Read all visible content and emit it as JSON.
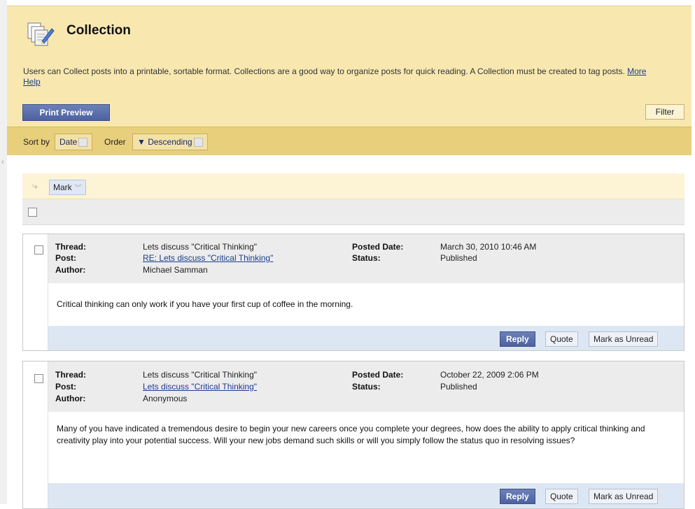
{
  "header": {
    "title": "Collection",
    "description": "Users can Collect posts into a printable, sortable format. Collections are a good way to organize posts for quick reading. A Collection must be created to tag posts.",
    "help_link": "More Help",
    "print_preview_label": "Print Preview",
    "filter_label": "Filter"
  },
  "sortbar": {
    "sort_by_label": "Sort by",
    "sort_value": "Date",
    "order_label": "Order",
    "order_value": "▼ Descending"
  },
  "markbar": {
    "mark_label": "Mark"
  },
  "labels": {
    "thread": "Thread:",
    "post": "Post:",
    "author": "Author:",
    "posted_date": "Posted Date:",
    "status": "Status:"
  },
  "posts": [
    {
      "thread": "Lets discuss \"Critical Thinking\"",
      "post": "RE: Lets discuss \"Critical Thinking\"",
      "author": "Michael Samman",
      "posted_date": "March 30, 2010 10:46 AM",
      "status": "Published",
      "body": "Critical thinking can only work if you have your first cup of coffee in the morning.",
      "reply_label": "Reply",
      "quote_label": "Quote",
      "unread_label": "Mark as Unread"
    },
    {
      "thread": "Lets discuss \"Critical Thinking\"",
      "post": "Lets discuss \"Critical Thinking\"",
      "author": "Anonymous",
      "posted_date": "October 22, 2009 2:06 PM",
      "status": "Published",
      "body": "Many of you have indicated a tremendous desire to begin your new careers once you complete your degrees, how does the ability to apply critical thinking and creativity play into your potential success. Will your new jobs demand such skills or will you simply follow the status quo in resolving issues?",
      "reply_label": "Reply",
      "quote_label": "Quote",
      "unread_label": "Mark as Unread"
    }
  ],
  "colors": {
    "header_bg": "#f8e8b0",
    "sortbar_bg": "#e8cf7c",
    "button_blue": "#5a6ea9",
    "link": "#1a3c8b"
  },
  "icons": {
    "collection": "collection-icon",
    "mark_arrow": "mark-arrow-icon"
  }
}
